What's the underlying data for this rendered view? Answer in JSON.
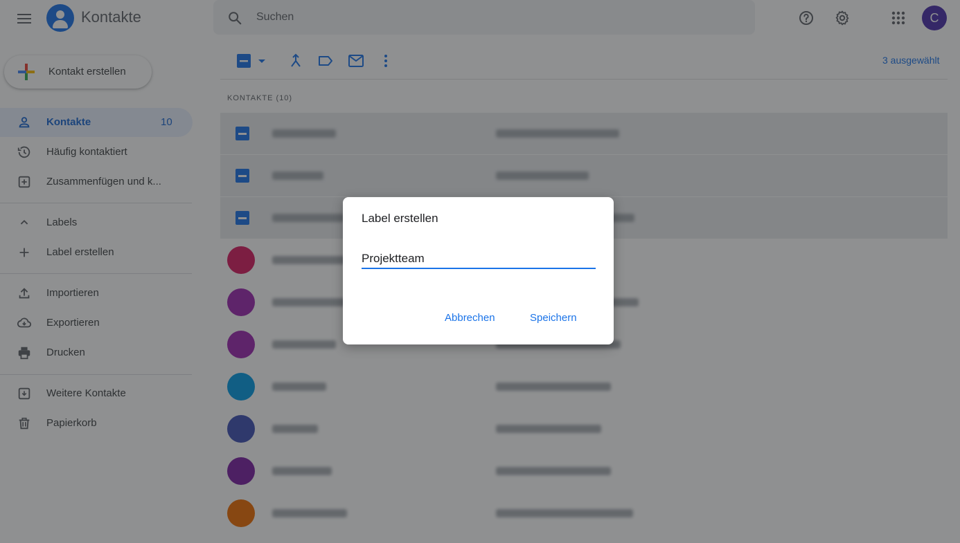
{
  "header": {
    "app_title": "Kontakte",
    "search_placeholder": "Suchen",
    "avatar_letter": "C",
    "avatar_color": "#4a2faa"
  },
  "sidebar": {
    "create_button_label": "Kontakt erstellen",
    "items": [
      {
        "label": "Kontakte",
        "count": "10",
        "icon": "person-icon",
        "active": true
      },
      {
        "label": "Häufig kontaktiert",
        "icon": "history-icon"
      },
      {
        "label": "Zusammenfügen und k...",
        "icon": "merge-icon"
      },
      {
        "label": "Labels",
        "icon": "chevron-up-icon"
      },
      {
        "label": "Label erstellen",
        "icon": "plus-icon"
      },
      {
        "label": "Importieren",
        "icon": "upload-icon"
      },
      {
        "label": "Exportieren",
        "icon": "cloud-download-icon"
      },
      {
        "label": "Drucken",
        "icon": "print-icon"
      },
      {
        "label": "Weitere Kontakte",
        "icon": "archive-icon"
      },
      {
        "label": "Papierkorb",
        "icon": "trash-icon"
      }
    ]
  },
  "main": {
    "selected_count": "3 ausgewählt",
    "list_header": "KONTAKTE (10)",
    "rows": [
      {
        "selected": true,
        "avatar_color": "#1a73e8"
      },
      {
        "selected": true,
        "avatar_color": "#1a73e8"
      },
      {
        "selected": true,
        "avatar_color": "#1a73e8"
      },
      {
        "selected": false,
        "avatar_color": "#d81b60"
      },
      {
        "selected": false,
        "avatar_color": "#9c27b0"
      },
      {
        "selected": false,
        "avatar_color": "#9c27b0"
      },
      {
        "selected": false,
        "avatar_color": "#039be5"
      },
      {
        "selected": false,
        "avatar_color": "#3f51b5"
      },
      {
        "selected": false,
        "avatar_color": "#7b1fa2"
      },
      {
        "selected": false,
        "avatar_color": "#ef6c00"
      }
    ]
  },
  "dialog": {
    "title": "Label erstellen",
    "input_value": "Projektteam",
    "cancel_label": "Abbrechen",
    "save_label": "Speichern"
  },
  "colors": {
    "accent": "#1a73e8",
    "active_nav_bg": "#e8f0fe"
  }
}
